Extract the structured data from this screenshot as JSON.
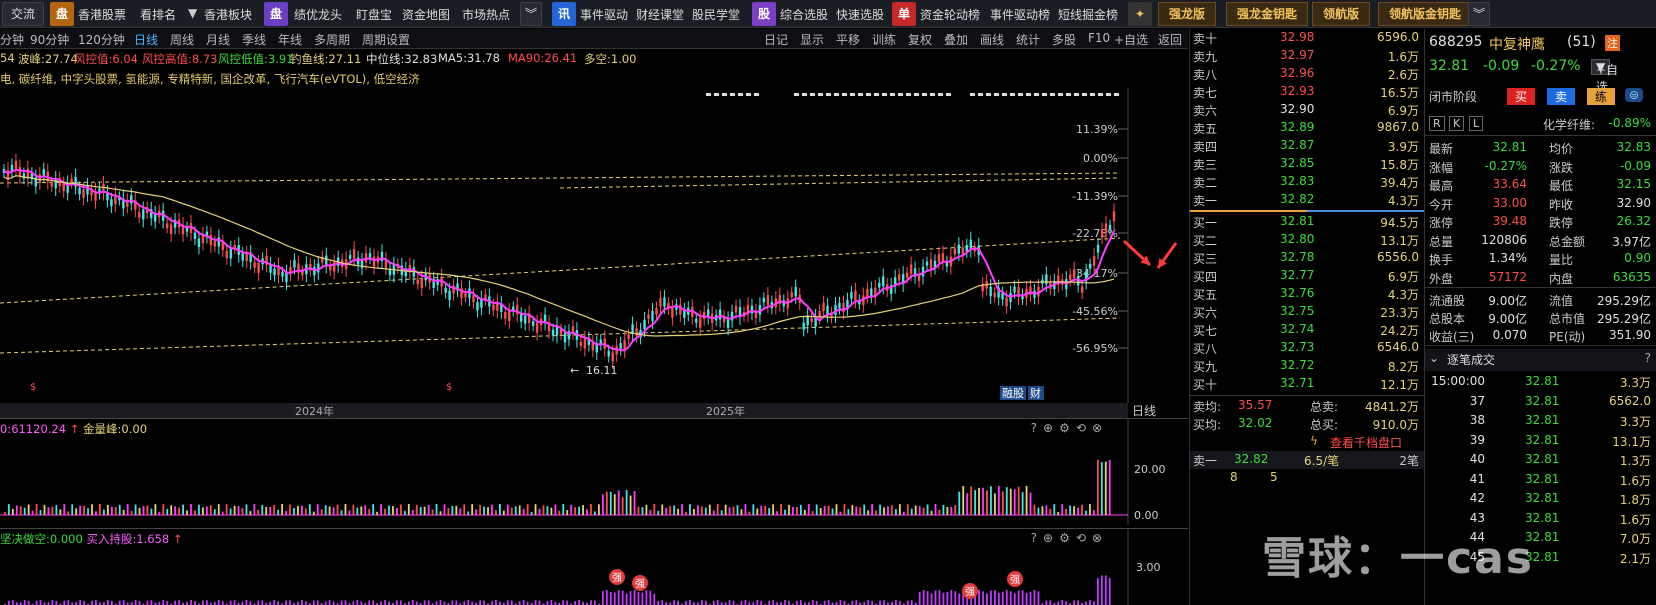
{
  "toolbar": {
    "jiaoliu": "交流",
    "tag_pan": "盘",
    "tag_pan_top": "盘",
    "hk_stock": "香港股票",
    "kanpaiming": "看排名",
    "hk_sector": "香港板块",
    "tag_pan2": "盘",
    "jiyou_longtou": "绩优龙头",
    "dingpanbao": "盯盘宝",
    "zijin_ditu": "资金地图",
    "shichang_redian": "市场热点",
    "tag_xun": "讯",
    "shijian_qudong": "事件驱动",
    "caijing_ketang": "财经课堂",
    "gumin_xuetang": "股民学堂",
    "tag_gu": "股",
    "zonghe_xuangu": "综合选股",
    "kuaisu_xuangu": "快速选股",
    "tag_dan": "单",
    "zijin_lundong": "资金轮动榜",
    "shijian_qudongbang": "事件驱动榜",
    "duanxian_juejin": "短线掘金榜",
    "qianglong": "强龙版",
    "qianglong_jin": "强龙金钥匙",
    "linghang": "领航版",
    "linghang_jin": "领航版金钥匙"
  },
  "timeframes": [
    "分钟",
    "90分钟",
    "120分钟",
    "日线",
    "周线",
    "月线",
    "季线",
    "年线",
    "多周期",
    "周期设置"
  ],
  "active_timeframe": "日线",
  "chart_tools": [
    "日记",
    "显示",
    "平移",
    "训练",
    "复权",
    "叠加",
    "画线",
    "统计",
    "多股",
    "F10",
    "+自选",
    "返回"
  ],
  "legend1": [
    {
      "text": "54",
      "color": "#e6d27a"
    },
    {
      "text": "波峰:27.74",
      "color": "#e6d27a"
    },
    {
      "text": "风控值:6.04",
      "color": "#ff4d4d"
    },
    {
      "text": "风控高值:8.73",
      "color": "#ff4d4d"
    },
    {
      "text": "风控低值:3.91",
      "color": "#3ddc3d"
    },
    {
      "text": "钓鱼线:27.11",
      "color": "#e6d27a"
    },
    {
      "text": "中位线:32.83",
      "color": "#e0e0e0"
    },
    {
      "text": "MA5:31.78",
      "color": "#e0e0e0"
    },
    {
      "text": "MA90:26.41",
      "color": "#ff4d4d"
    },
    {
      "text": "多空:1.00",
      "color": "#e6d27a"
    }
  ],
  "legend2": "电, 碳纤维, 中字头股票, 氢能源, 专精特新, 国企改革, 飞行汽车(eVTOL), 低空经济",
  "axis_pct": [
    "11.39%",
    "0.00%",
    "-11.39%",
    "-22.78%",
    "-34.17%",
    "-45.56%",
    "-56.95%"
  ],
  "year_labels": [
    "2024年",
    "2025年"
  ],
  "bottom_axis_label": "日线",
  "low_marker": "16.11",
  "badges": [
    "融",
    "股",
    "财"
  ],
  "vol_panel": {
    "title_a": "0:61120.24",
    "title_b": "金量峰:0.00",
    "ticks": [
      "20.00",
      "0.00"
    ]
  },
  "ind_panel": {
    "title_a": "坚决做空:0.000",
    "title_b": "买入持股:1.658",
    "ticks": [
      "3.00"
    ],
    "badge": "强"
  },
  "orderbook": {
    "asks": [
      {
        "label": "卖十",
        "price": "32.98",
        "vol": "6596.0",
        "color": "#ff4d4d"
      },
      {
        "label": "卖九",
        "price": "32.97",
        "vol": "1.6万",
        "color": "#ff4d4d"
      },
      {
        "label": "卖八",
        "price": "32.96",
        "vol": "2.6万",
        "color": "#ff4d4d"
      },
      {
        "label": "卖七",
        "price": "32.93",
        "vol": "16.5万",
        "color": "#ff4d4d"
      },
      {
        "label": "卖六",
        "price": "32.90",
        "vol": "6.9万",
        "color": "#e0e0e0"
      },
      {
        "label": "卖五",
        "price": "32.89",
        "vol": "9867.0",
        "color": "#3ddc3d"
      },
      {
        "label": "卖四",
        "price": "32.87",
        "vol": "3.9万",
        "color": "#3ddc3d"
      },
      {
        "label": "卖三",
        "price": "32.85",
        "vol": "15.8万",
        "color": "#3ddc3d"
      },
      {
        "label": "卖二",
        "price": "32.83",
        "vol": "39.4万",
        "color": "#3ddc3d"
      },
      {
        "label": "卖一",
        "price": "32.82",
        "vol": "4.3万",
        "color": "#3ddc3d"
      }
    ],
    "bids": [
      {
        "label": "买一",
        "price": "32.81",
        "vol": "94.5万",
        "color": "#3ddc3d"
      },
      {
        "label": "买二",
        "price": "32.80",
        "vol": "13.1万",
        "color": "#3ddc3d"
      },
      {
        "label": "买三",
        "price": "32.78",
        "vol": "6556.0",
        "color": "#3ddc3d"
      },
      {
        "label": "买四",
        "price": "32.77",
        "vol": "6.9万",
        "color": "#3ddc3d"
      },
      {
        "label": "买五",
        "price": "32.76",
        "vol": "4.3万",
        "color": "#3ddc3d"
      },
      {
        "label": "买六",
        "price": "32.75",
        "vol": "23.3万",
        "color": "#3ddc3d"
      },
      {
        "label": "买七",
        "price": "32.74",
        "vol": "24.2万",
        "color": "#3ddc3d"
      },
      {
        "label": "买八",
        "price": "32.73",
        "vol": "6546.0",
        "color": "#3ddc3d"
      },
      {
        "label": "买九",
        "price": "32.72",
        "vol": "8.2万",
        "color": "#3ddc3d"
      },
      {
        "label": "买十",
        "price": "32.71",
        "vol": "12.1万",
        "color": "#3ddc3d"
      }
    ],
    "sell_avg_label": "卖均:",
    "sell_avg": "35.57",
    "total_sell_label": "总卖:",
    "total_sell": "4841.2万",
    "buy_avg_label": "买均:",
    "buy_avg": "32.02",
    "total_buy_label": "总买:",
    "total_buy": "910.0万",
    "view_1000": "查看千档盘口",
    "sell1_label": "卖一",
    "sell1_price": "32.82",
    "sell1_per": "6.5/笔",
    "sell1_count": "2笔",
    "queue_a": "8",
    "queue_b": "5"
  },
  "quote": {
    "code": "688295",
    "name": "中复神鹰",
    "count": "(51)",
    "tag": "注",
    "price": "32.81",
    "change": "-0.09",
    "change_pct": "-0.27%",
    "add_watch": "+自选",
    "phase": "闭市阶段",
    "buy": "买",
    "sell": "卖",
    "practice": "练",
    "rkl": [
      "R",
      "K",
      "L"
    ],
    "sector": "化学纤维:",
    "sector_pct": "-0.89%",
    "stats": [
      {
        "l": "最新",
        "v": "32.81",
        "vc": "#3ddc3d",
        "l2": "均价",
        "v2": "32.83",
        "vc2": "#3ddc3d"
      },
      {
        "l": "涨幅",
        "v": "-0.27%",
        "vc": "#3ddc3d",
        "l2": "涨跌",
        "v2": "-0.09",
        "vc2": "#3ddc3d"
      },
      {
        "l": "最高",
        "v": "33.64",
        "vc": "#ff4d4d",
        "l2": "最低",
        "v2": "32.15",
        "vc2": "#3ddc3d"
      },
      {
        "l": "今开",
        "v": "33.00",
        "vc": "#ff4d4d",
        "l2": "昨收",
        "v2": "32.90",
        "vc2": "#e0e0e0"
      },
      {
        "l": "涨停",
        "v": "39.48",
        "vc": "#ff4d4d",
        "l2": "跌停",
        "v2": "26.32",
        "vc2": "#3ddc3d"
      },
      {
        "l": "总量",
        "v": "120806",
        "vc": "#e0e0e0",
        "l2": "总金额",
        "v2": "3.97亿",
        "vc2": "#e0e0e0"
      },
      {
        "l": "换手",
        "v": "1.34%",
        "vc": "#e0e0e0",
        "l2": "量比",
        "v2": "0.90",
        "vc2": "#3ddc3d"
      },
      {
        "l": "外盘",
        "v": "57172",
        "vc": "#ff4d4d",
        "l2": "内盘",
        "v2": "63635",
        "vc2": "#3ddc3d"
      }
    ],
    "stats2": [
      {
        "l": "流通股",
        "v": "9.00亿",
        "l2": "流值",
        "v2": "295.29亿"
      },
      {
        "l": "总股本",
        "v": "9.00亿",
        "l2": "总市值",
        "v2": "295.29亿"
      },
      {
        "l": "收益(三)",
        "v": "0.070",
        "l2": "PE(动)",
        "v2": "351.90"
      }
    ],
    "ticks_title": "逐笔成交",
    "ticks": [
      {
        "t": "15:00:00",
        "p": "32.81",
        "v": "3.3万"
      },
      {
        "t": "37",
        "p": "32.81",
        "v": "6562.0"
      },
      {
        "t": "38",
        "p": "32.81",
        "v": "3.3万"
      },
      {
        "t": "39",
        "p": "32.81",
        "v": "13.1万"
      },
      {
        "t": "40",
        "p": "32.81",
        "v": "1.3万"
      },
      {
        "t": "41",
        "p": "32.81",
        "v": "1.6万"
      },
      {
        "t": "42",
        "p": "32.81",
        "v": "1.8万"
      },
      {
        "t": "43",
        "p": "32.81",
        "v": "1.6万"
      },
      {
        "t": "44",
        "p": "32.81",
        "v": "7.0万"
      },
      {
        "t": "45",
        "p": "32.81",
        "v": "2.1万"
      }
    ]
  },
  "watermark": "雪球：一cas",
  "colors": {
    "up": "#ff4d4d",
    "down": "#3ddc3d",
    "ma_magenta": "#ff3cff",
    "ma_yellow": "#e6d27a",
    "accent_blue": "#4db6ff"
  }
}
